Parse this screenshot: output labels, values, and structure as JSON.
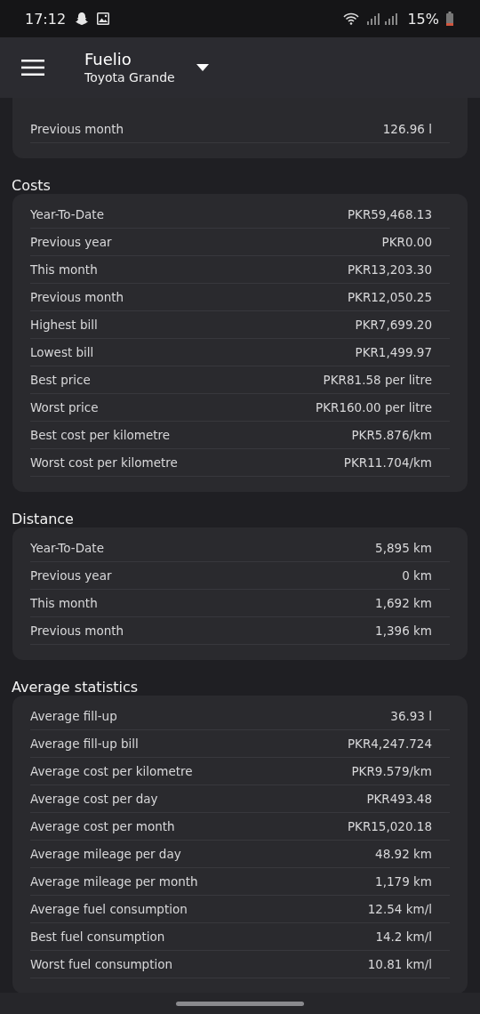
{
  "status_bar": {
    "time": "17:12",
    "battery": "15%"
  },
  "app_bar": {
    "title": "Fuelio",
    "subtitle": "Toyota Grande"
  },
  "sections": [
    {
      "rows": [
        {
          "label": "Previous month",
          "value": "126.96 l"
        }
      ]
    },
    {
      "heading": "Costs",
      "rows": [
        {
          "label": "Year-To-Date",
          "value": "PKR59,468.13"
        },
        {
          "label": "Previous year",
          "value": "PKR0.00"
        },
        {
          "label": "This month",
          "value": "PKR13,203.30"
        },
        {
          "label": "Previous month",
          "value": "PKR12,050.25"
        },
        {
          "label": "Highest bill",
          "value": "PKR7,699.20"
        },
        {
          "label": "Lowest bill",
          "value": "PKR1,499.97"
        },
        {
          "label": "Best price",
          "value": "PKR81.58 per litre"
        },
        {
          "label": "Worst price",
          "value": "PKR160.00 per litre"
        },
        {
          "label": "Best cost per kilometre",
          "value": "PKR5.876/km"
        },
        {
          "label": "Worst cost per kilometre",
          "value": "PKR11.704/km"
        }
      ]
    },
    {
      "heading": "Distance",
      "rows": [
        {
          "label": "Year-To-Date",
          "value": "5,895 km"
        },
        {
          "label": "Previous year",
          "value": "0 km"
        },
        {
          "label": "This month",
          "value": "1,692 km"
        },
        {
          "label": "Previous month",
          "value": "1,396 km"
        }
      ]
    },
    {
      "heading": "Average statistics",
      "rows": [
        {
          "label": "Average fill-up",
          "value": "36.93 l"
        },
        {
          "label": "Average fill-up bill",
          "value": "PKR4,247.724"
        },
        {
          "label": "Average cost per kilometre",
          "value": "PKR9.579/km"
        },
        {
          "label": "Average cost per day",
          "value": "PKR493.48"
        },
        {
          "label": "Average cost per month",
          "value": "PKR15,020.18"
        },
        {
          "label": "Average mileage per day",
          "value": "48.92 km"
        },
        {
          "label": "Average mileage per month",
          "value": "1,179 km"
        },
        {
          "label": "Average fuel consumption",
          "value": "12.54 km/l"
        },
        {
          "label": "Best fuel consumption",
          "value": "14.2 km/l"
        },
        {
          "label": "Worst fuel consumption",
          "value": "10.81 km/l"
        }
      ]
    }
  ]
}
